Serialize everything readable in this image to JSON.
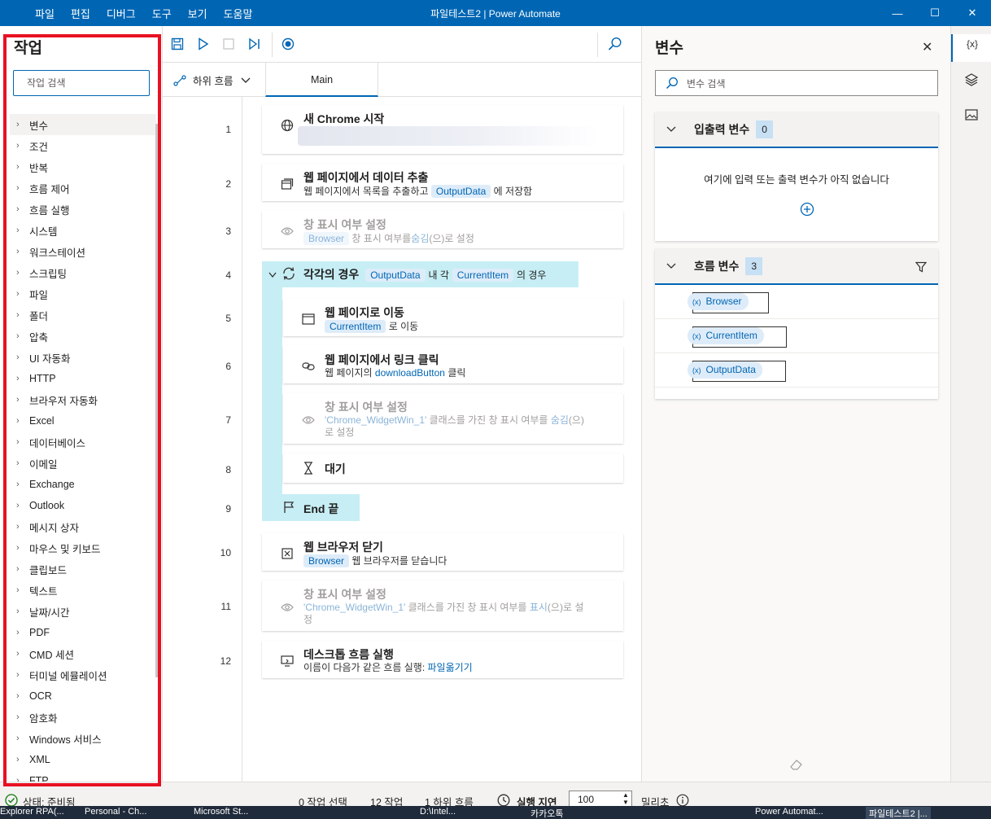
{
  "menu": [
    "파일",
    "편집",
    "디버그",
    "도구",
    "보기",
    "도움말"
  ],
  "window_title": "파일테스트2 | Power Automate",
  "window_controls": {
    "minimize": "—",
    "maximize": "☐",
    "close": "✕"
  },
  "actions_panel": {
    "title": "작업",
    "search_placeholder": "작업 검색",
    "items": [
      "변수",
      "조건",
      "반복",
      "흐름 제어",
      "흐름 실행",
      "시스템",
      "워크스테이션",
      "스크립팅",
      "파일",
      "폴더",
      "압축",
      "UI 자동화",
      "HTTP",
      "브라우저 자동화",
      "Excel",
      "데이터베이스",
      "이메일",
      "Exchange",
      "Outlook",
      "메시지 상자",
      "마우스 및 키보드",
      "클립보드",
      "텍스트",
      "날짜/시간",
      "PDF",
      "CMD 세션",
      "터미널 에뮬레이션",
      "OCR",
      "암호화",
      "Windows 서비스",
      "XML",
      "FTP"
    ]
  },
  "subflow": {
    "dropdown_label": "하위 흐름",
    "tab_main": "Main"
  },
  "steps": [
    {
      "no": "1",
      "title": "새 Chrome 시작"
    },
    {
      "no": "2",
      "title": "웹 페이지에서 데이터 추출",
      "d1": "웹 페이지에서 목록을 추출하고",
      "var": "OutputData",
      "d2": "에 저장함"
    },
    {
      "no": "3",
      "title": "창 표시 여부 설정",
      "var": "Browser",
      "d1": "창 표시 여부를",
      "link": "숨김",
      "d2": "(으)로 설정"
    },
    {
      "no": "4",
      "title": "각각의 경우",
      "var1": "OutputData",
      "mid": "내 각",
      "var2": "CurrentItem",
      "end": "의 경우"
    },
    {
      "no": "5",
      "title": "웹 페이지로 이동",
      "var": "CurrentItem",
      "d2": "로 이동"
    },
    {
      "no": "6",
      "title": "웹 페이지에서 링크 클릭",
      "d1": "웹 페이지의",
      "link": "downloadButton",
      "d2": "클릭"
    },
    {
      "no": "7",
      "title": "창 표시 여부 설정",
      "var": "'Chrome_WidgetWin_1'",
      "d1": "클래스를 가진 창 표시 여부를",
      "link": "숨김",
      "d2": "(으)",
      "d3": "로 설정"
    },
    {
      "no": "8",
      "title": "대기"
    },
    {
      "no": "9",
      "title": "End 끝"
    },
    {
      "no": "10",
      "title": "웹 브라우저 닫기",
      "var": "Browser",
      "d2": "웹 브라우저를 닫습니다"
    },
    {
      "no": "11",
      "title": "창 표시 여부 설정",
      "var": "'Chrome_WidgetWin_1'",
      "d1": "클래스를 가진 창 표시 여부를",
      "link": "표시",
      "d2": "(으)로 설",
      "d3": "정"
    },
    {
      "no": "12",
      "title": "데스크톱 흐름 실행",
      "d1": "이름이 다음가 같은 흐름 실행:",
      "link": "파일옮기기"
    }
  ],
  "variables_panel": {
    "title": "변수",
    "search_placeholder": "변수 검색",
    "io_section": {
      "title": "입출력 변수",
      "count": "0",
      "empty_text": "여기에 입력 또는 출력 변수가 아직 없습니다"
    },
    "flow_section": {
      "title": "흐름 변수",
      "count": "3",
      "vars": [
        "Browser",
        "CurrentItem",
        "OutputData"
      ]
    },
    "var_chip_prefix": "(x)"
  },
  "right_strip": {
    "variables_icon_label": "{x}"
  },
  "status": {
    "state": "상태: 준비됨",
    "selected": "0 작업 선택",
    "actions": "12 작업",
    "subflows": "1 하위 흐름",
    "delay_label": "실행 지연",
    "delay_value": "100",
    "delay_unit": "밀리초"
  },
  "taskbar": [
    "Explorer RPA(...",
    "Personal - Ch...",
    "Microsoft St...",
    "",
    "",
    "",
    "D:\\Intel...",
    "카카오톡",
    "",
    "",
    "Power Automat...",
    "파일테스트2 |..."
  ]
}
